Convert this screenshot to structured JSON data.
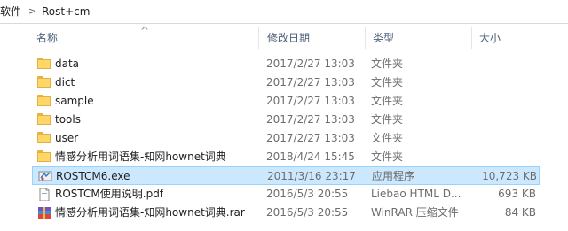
{
  "breadcrumb": {
    "parent": "软件",
    "current": "Rost+cm"
  },
  "columns": {
    "name": "名称",
    "date": "修改日期",
    "type": "类型",
    "size": "大小"
  },
  "rows": [
    {
      "name": "data",
      "date": "2017/2/27 13:03",
      "type": "文件夹",
      "size": "",
      "icon": "folder-icon"
    },
    {
      "name": "dict",
      "date": "2017/2/27 13:03",
      "type": "文件夹",
      "size": "",
      "icon": "folder-icon"
    },
    {
      "name": "sample",
      "date": "2017/2/27 13:03",
      "type": "文件夹",
      "size": "",
      "icon": "folder-icon"
    },
    {
      "name": "tools",
      "date": "2017/2/27 13:03",
      "type": "文件夹",
      "size": "",
      "icon": "folder-icon"
    },
    {
      "name": "user",
      "date": "2017/2/27 13:03",
      "type": "文件夹",
      "size": "",
      "icon": "folder-icon"
    },
    {
      "name": "情感分析用词语集-知网hownet词典",
      "date": "2018/4/24 15:45",
      "type": "文件夹",
      "size": "",
      "icon": "folder-icon"
    },
    {
      "name": "ROSTCM6.exe",
      "date": "2011/3/16 23:17",
      "type": "应用程序",
      "size": "10,723 KB",
      "icon": "exe-icon"
    },
    {
      "name": "ROSTCM使用说明.pdf",
      "date": "2016/5/3 20:55",
      "type": "Liebao HTML D...",
      "size": "693 KB",
      "icon": "pdf-icon"
    },
    {
      "name": "情感分析用词语集-知网hownet词典.rar",
      "date": "2016/5/3 20:55",
      "type": "WinRAR 压缩文件",
      "size": "84 KB",
      "icon": "rar-icon"
    }
  ],
  "colors": {
    "selection": "#cce8ff",
    "header_text": "#4c607a",
    "folder": "#ffd767"
  }
}
